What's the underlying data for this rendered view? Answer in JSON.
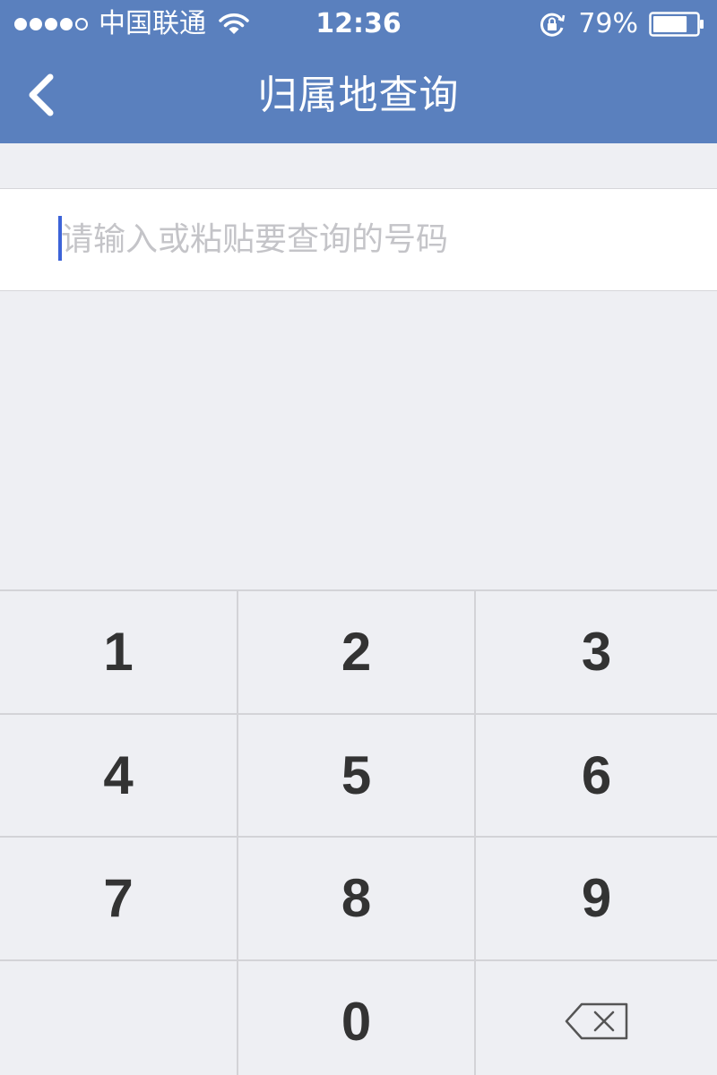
{
  "status_bar": {
    "carrier": "中国联通",
    "time": "12:36",
    "battery_percent": "79%",
    "signal_bars": 4,
    "signal_max": 5,
    "battery_level": 0.79,
    "icons": [
      "signal-dots-icon",
      "wifi-icon",
      "rotation-lock-icon",
      "battery-icon"
    ]
  },
  "nav": {
    "title": "归属地查询",
    "back_icon": "chevron-left-icon"
  },
  "search": {
    "placeholder": "请输入或粘贴要查询的号码",
    "value": ""
  },
  "keypad": {
    "keys": [
      "1",
      "2",
      "3",
      "4",
      "5",
      "6",
      "7",
      "8",
      "9",
      "",
      "0",
      "backspace"
    ],
    "delete_icon": "backspace-icon"
  },
  "colors": {
    "header_bg": "#5a80be",
    "page_bg": "#eeeff3",
    "cursor": "#3c63d8",
    "key_text": "#333333",
    "placeholder": "#c4c4c8"
  }
}
